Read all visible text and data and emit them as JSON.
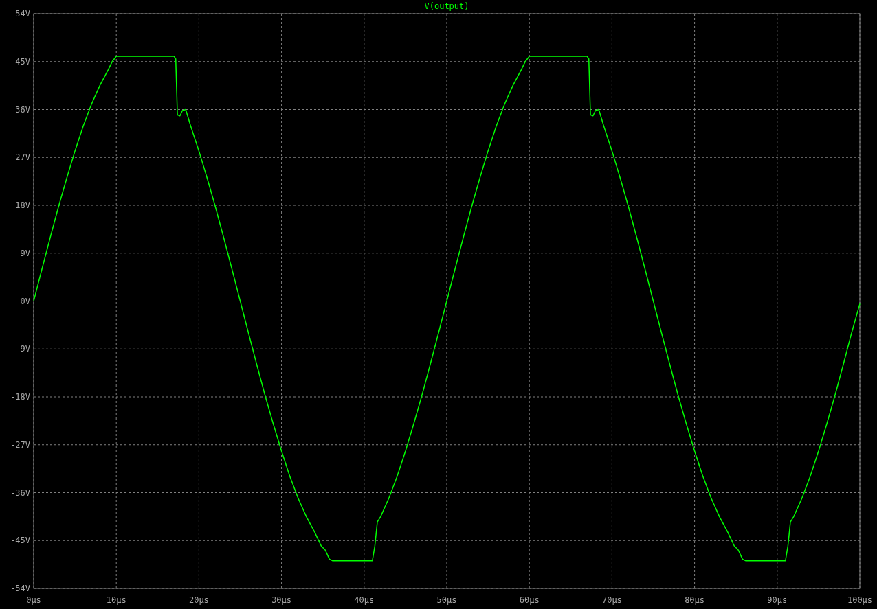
{
  "plot": {
    "chart_data": {
      "type": "line",
      "grid": true,
      "x": [
        0,
        1,
        2,
        3,
        4,
        5,
        6,
        7,
        8,
        9,
        9.5,
        10,
        17,
        17.2,
        17.4,
        17.7,
        18,
        18.4,
        19,
        20,
        21,
        22,
        23,
        24,
        25,
        26,
        27,
        28,
        29,
        30,
        31,
        32,
        33,
        34,
        34.8,
        35.3,
        35.8,
        36.2,
        41,
        41.3,
        41.6,
        42,
        43,
        44,
        45,
        46,
        47,
        48,
        49,
        50,
        51,
        52,
        53,
        54,
        55,
        56,
        57,
        58,
        59,
        59.5,
        60,
        67,
        67.2,
        67.4,
        67.7,
        68,
        68.4,
        69,
        70,
        71,
        72,
        73,
        74,
        75,
        76,
        77,
        78,
        79,
        80,
        81,
        82,
        83,
        84,
        84.8,
        85.3,
        85.8,
        86.2,
        91,
        91.3,
        91.6,
        92,
        93,
        94,
        95,
        96,
        97,
        98,
        99,
        100
      ],
      "series": [
        {
          "name": "V(output)",
          "color": "#00ff00",
          "values": [
            0,
            6.0,
            11.9,
            17.7,
            23.1,
            28.2,
            32.9,
            37.0,
            40.5,
            43.4,
            45,
            46,
            46,
            45.5,
            35,
            34.8,
            35.8,
            36,
            32.9,
            28.2,
            23.1,
            17.7,
            11.9,
            6.0,
            0,
            -6.0,
            -11.9,
            -17.7,
            -23.1,
            -28.2,
            -32.9,
            -37.0,
            -40.5,
            -43.4,
            -46,
            -46.8,
            -48.5,
            -48.8,
            -48.8,
            -46,
            -41.5,
            -40.5,
            -37.0,
            -32.9,
            -28.2,
            -23.1,
            -17.7,
            -11.9,
            -6.0,
            0,
            6.0,
            11.9,
            17.7,
            23.1,
            28.2,
            32.9,
            37.0,
            40.5,
            43.4,
            45,
            46,
            46,
            45.5,
            35,
            34.8,
            35.8,
            36,
            32.9,
            28.2,
            23.1,
            17.7,
            11.9,
            6.0,
            0,
            -6.0,
            -11.9,
            -17.7,
            -23.1,
            -28.2,
            -32.9,
            -37.0,
            -40.5,
            -43.4,
            -46,
            -46.8,
            -48.5,
            -48.8,
            -48.8,
            -46,
            -41.5,
            -40.5,
            -37.0,
            -32.9,
            -28.2,
            -23.1,
            -17.7,
            -11.9,
            -6.0,
            -0.5
          ]
        }
      ],
      "xlim": [
        0,
        100
      ],
      "ylim": [
        -54,
        54
      ],
      "xticks": [
        {
          "value": 0,
          "label": "0µs"
        },
        {
          "value": 10,
          "label": "10µs"
        },
        {
          "value": 20,
          "label": "20µs"
        },
        {
          "value": 30,
          "label": "30µs"
        },
        {
          "value": 40,
          "label": "40µs"
        },
        {
          "value": 50,
          "label": "50µs"
        },
        {
          "value": 60,
          "label": "60µs"
        },
        {
          "value": 70,
          "label": "70µs"
        },
        {
          "value": 80,
          "label": "80µs"
        },
        {
          "value": 90,
          "label": "90µs"
        },
        {
          "value": 100,
          "label": "100µs"
        }
      ],
      "yticks": [
        {
          "value": 54,
          "label": "54V"
        },
        {
          "value": 45,
          "label": "45V"
        },
        {
          "value": 36,
          "label": "36V"
        },
        {
          "value": 27,
          "label": "27V"
        },
        {
          "value": 18,
          "label": "18V"
        },
        {
          "value": 9,
          "label": "9V"
        },
        {
          "value": 0,
          "label": "0V"
        },
        {
          "value": -9,
          "label": "-9V"
        },
        {
          "value": -18,
          "label": "-18V"
        },
        {
          "value": -27,
          "label": "-27V"
        },
        {
          "value": -36,
          "label": "-36V"
        },
        {
          "value": -45,
          "label": "-45V"
        },
        {
          "value": -54,
          "label": "-54V"
        }
      ]
    }
  }
}
